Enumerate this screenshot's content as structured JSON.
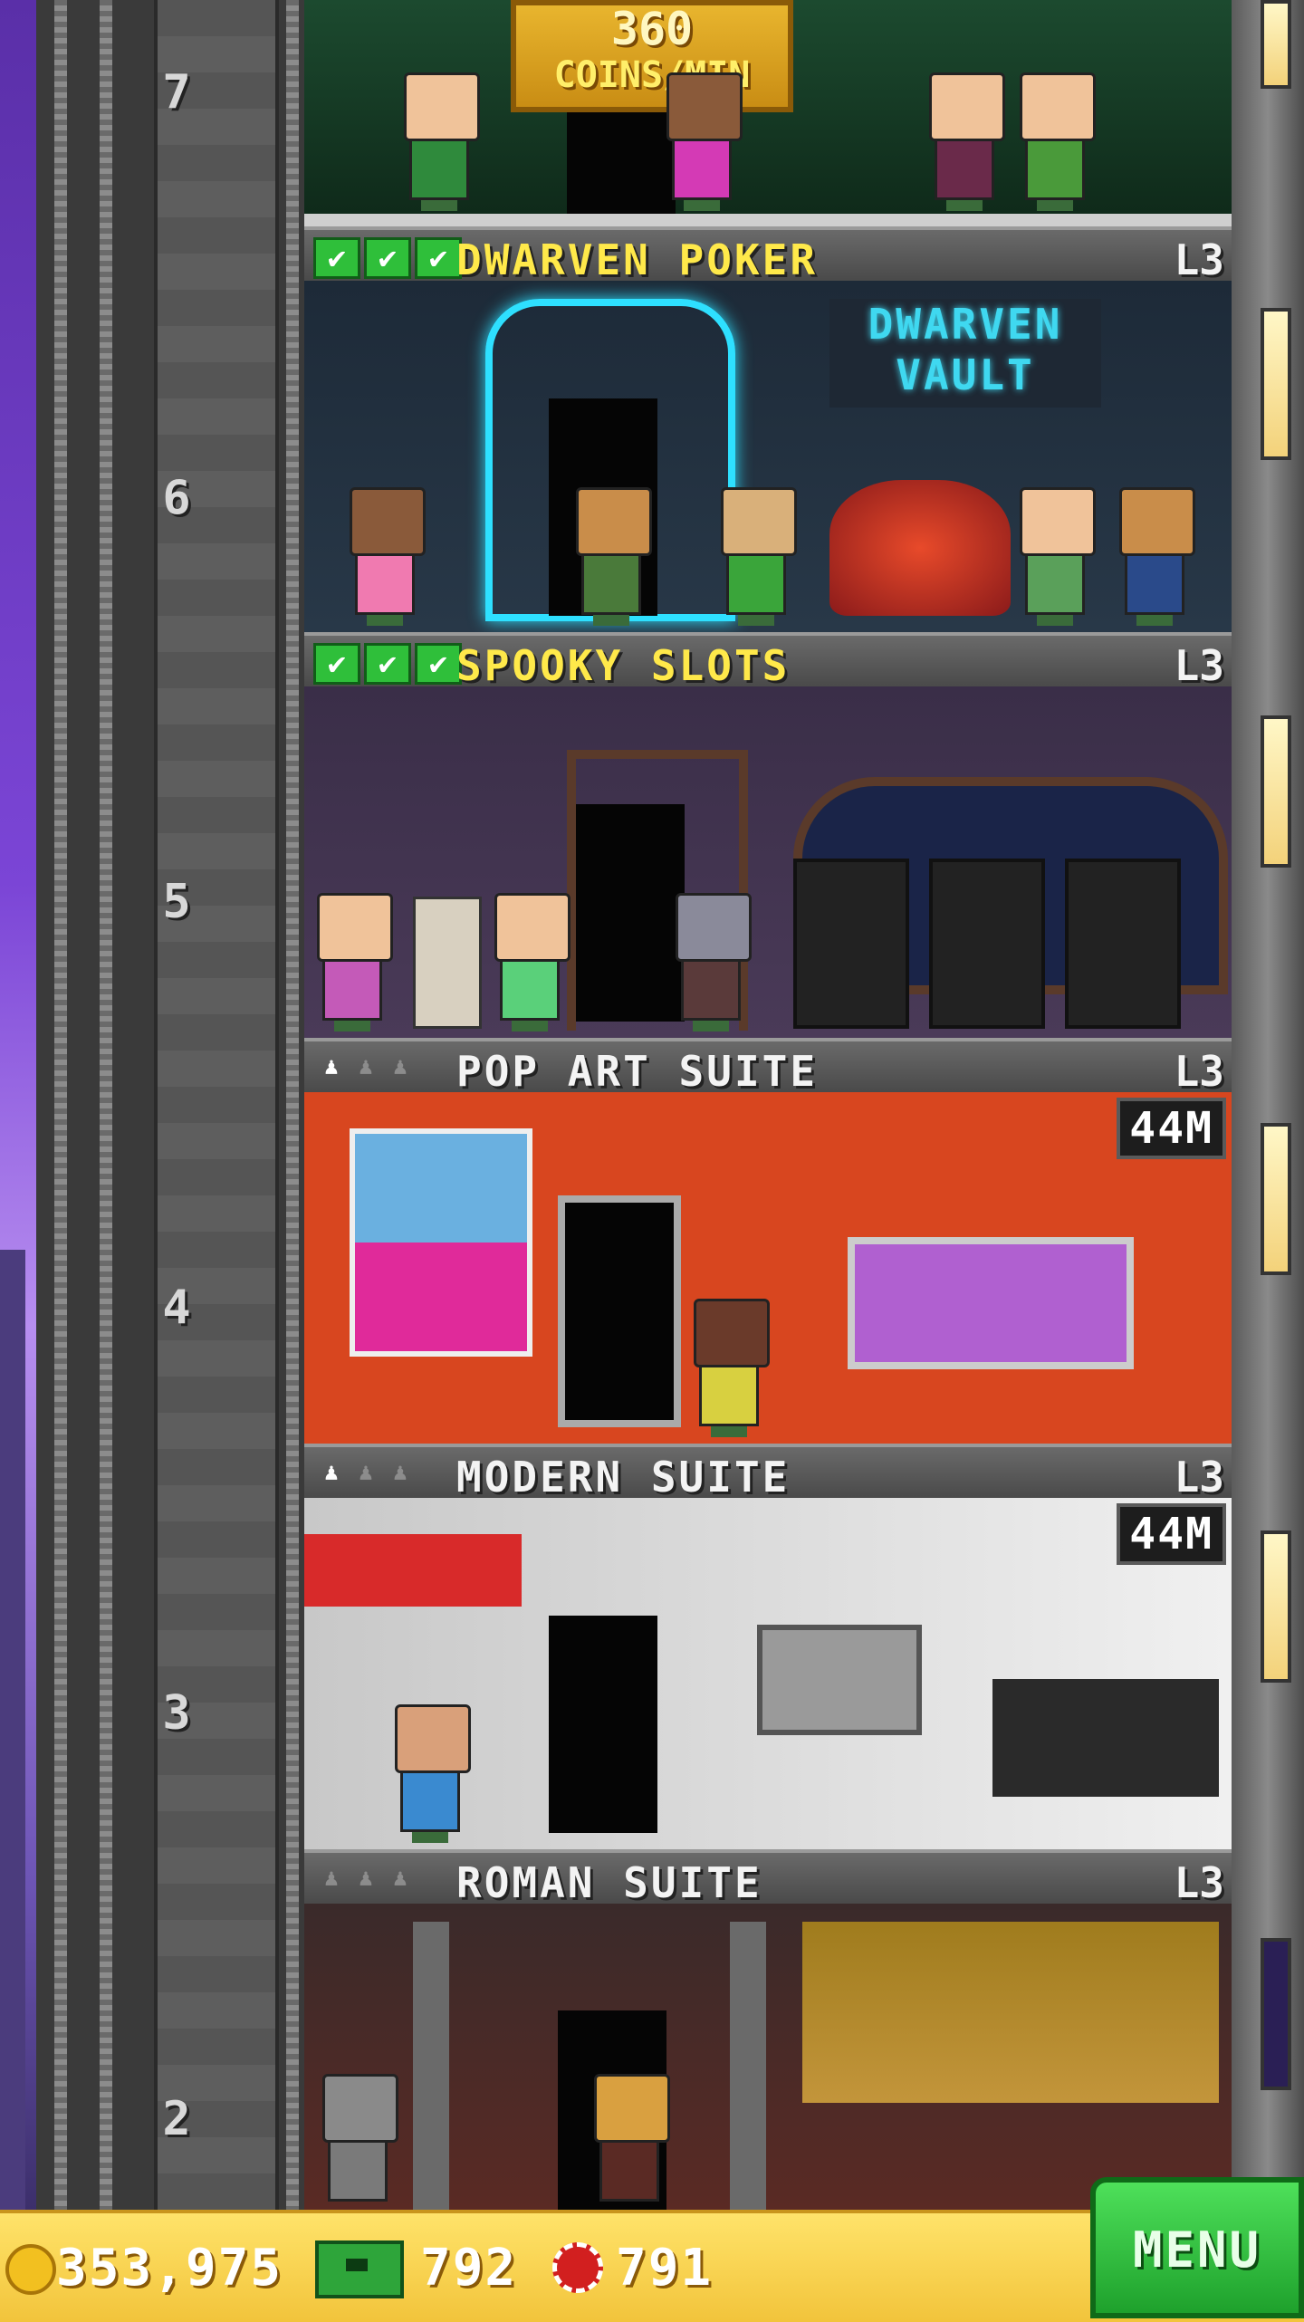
{
  "tower": {
    "top_floor": {
      "floor_number": "7",
      "coins_rate_value": "360",
      "coins_rate_unit": "COINS/MIN"
    },
    "floors": [
      {
        "number": "6",
        "name": "DWARVEN POKER",
        "level": "L3",
        "status": "stocked",
        "room_sign": "DWARVEN VAULT",
        "badge": ""
      },
      {
        "number": "5",
        "name": "SPOOKY SLOTS",
        "level": "L3",
        "status": "stocked",
        "badge": ""
      },
      {
        "number": "4",
        "name": "POP ART SUITE",
        "level": "L3",
        "status": "residential",
        "residents_filled": 1,
        "residents_total": 3,
        "badge": "44M"
      },
      {
        "number": "3",
        "name": "MODERN SUITE",
        "level": "L3",
        "status": "residential",
        "residents_filled": 1,
        "residents_total": 3,
        "badge": "44M"
      },
      {
        "number": "2",
        "name": "ROMAN SUITE",
        "level": "L3",
        "status": "residential",
        "residents_filled": 0,
        "residents_total": 3,
        "badge": ""
      }
    ]
  },
  "hud": {
    "coins": "353,975",
    "bux": "792",
    "chips": "791",
    "menu_label": "MENU"
  },
  "icons": {
    "coin": "coin-icon",
    "bux": "tower-bux-icon",
    "chip": "casino-chip-icon",
    "check": "check-icon",
    "person": "person-icon"
  },
  "colors": {
    "hud_gold": "#f2c43b",
    "menu_green": "#1ea12c",
    "check_green": "#2fbf3a",
    "title_yellow": "#ffe94a"
  }
}
